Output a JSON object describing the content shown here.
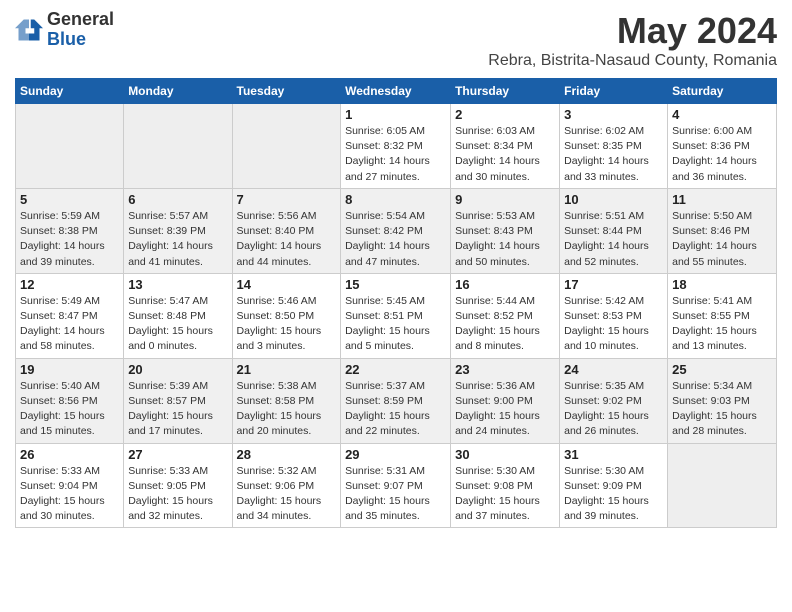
{
  "header": {
    "logo": {
      "line1": "General",
      "line2": "Blue"
    },
    "title": "May 2024",
    "location": "Rebra, Bistrita-Nasaud County, Romania"
  },
  "calendar": {
    "weekdays": [
      "Sunday",
      "Monday",
      "Tuesday",
      "Wednesday",
      "Thursday",
      "Friday",
      "Saturday"
    ],
    "weeks": [
      [
        {
          "day": "",
          "info": ""
        },
        {
          "day": "",
          "info": ""
        },
        {
          "day": "",
          "info": ""
        },
        {
          "day": "1",
          "info": "Sunrise: 6:05 AM\nSunset: 8:32 PM\nDaylight: 14 hours\nand 27 minutes."
        },
        {
          "day": "2",
          "info": "Sunrise: 6:03 AM\nSunset: 8:34 PM\nDaylight: 14 hours\nand 30 minutes."
        },
        {
          "day": "3",
          "info": "Sunrise: 6:02 AM\nSunset: 8:35 PM\nDaylight: 14 hours\nand 33 minutes."
        },
        {
          "day": "4",
          "info": "Sunrise: 6:00 AM\nSunset: 8:36 PM\nDaylight: 14 hours\nand 36 minutes."
        }
      ],
      [
        {
          "day": "5",
          "info": "Sunrise: 5:59 AM\nSunset: 8:38 PM\nDaylight: 14 hours\nand 39 minutes."
        },
        {
          "day": "6",
          "info": "Sunrise: 5:57 AM\nSunset: 8:39 PM\nDaylight: 14 hours\nand 41 minutes."
        },
        {
          "day": "7",
          "info": "Sunrise: 5:56 AM\nSunset: 8:40 PM\nDaylight: 14 hours\nand 44 minutes."
        },
        {
          "day": "8",
          "info": "Sunrise: 5:54 AM\nSunset: 8:42 PM\nDaylight: 14 hours\nand 47 minutes."
        },
        {
          "day": "9",
          "info": "Sunrise: 5:53 AM\nSunset: 8:43 PM\nDaylight: 14 hours\nand 50 minutes."
        },
        {
          "day": "10",
          "info": "Sunrise: 5:51 AM\nSunset: 8:44 PM\nDaylight: 14 hours\nand 52 minutes."
        },
        {
          "day": "11",
          "info": "Sunrise: 5:50 AM\nSunset: 8:46 PM\nDaylight: 14 hours\nand 55 minutes."
        }
      ],
      [
        {
          "day": "12",
          "info": "Sunrise: 5:49 AM\nSunset: 8:47 PM\nDaylight: 14 hours\nand 58 minutes."
        },
        {
          "day": "13",
          "info": "Sunrise: 5:47 AM\nSunset: 8:48 PM\nDaylight: 15 hours\nand 0 minutes."
        },
        {
          "day": "14",
          "info": "Sunrise: 5:46 AM\nSunset: 8:50 PM\nDaylight: 15 hours\nand 3 minutes."
        },
        {
          "day": "15",
          "info": "Sunrise: 5:45 AM\nSunset: 8:51 PM\nDaylight: 15 hours\nand 5 minutes."
        },
        {
          "day": "16",
          "info": "Sunrise: 5:44 AM\nSunset: 8:52 PM\nDaylight: 15 hours\nand 8 minutes."
        },
        {
          "day": "17",
          "info": "Sunrise: 5:42 AM\nSunset: 8:53 PM\nDaylight: 15 hours\nand 10 minutes."
        },
        {
          "day": "18",
          "info": "Sunrise: 5:41 AM\nSunset: 8:55 PM\nDaylight: 15 hours\nand 13 minutes."
        }
      ],
      [
        {
          "day": "19",
          "info": "Sunrise: 5:40 AM\nSunset: 8:56 PM\nDaylight: 15 hours\nand 15 minutes."
        },
        {
          "day": "20",
          "info": "Sunrise: 5:39 AM\nSunset: 8:57 PM\nDaylight: 15 hours\nand 17 minutes."
        },
        {
          "day": "21",
          "info": "Sunrise: 5:38 AM\nSunset: 8:58 PM\nDaylight: 15 hours\nand 20 minutes."
        },
        {
          "day": "22",
          "info": "Sunrise: 5:37 AM\nSunset: 8:59 PM\nDaylight: 15 hours\nand 22 minutes."
        },
        {
          "day": "23",
          "info": "Sunrise: 5:36 AM\nSunset: 9:00 PM\nDaylight: 15 hours\nand 24 minutes."
        },
        {
          "day": "24",
          "info": "Sunrise: 5:35 AM\nSunset: 9:02 PM\nDaylight: 15 hours\nand 26 minutes."
        },
        {
          "day": "25",
          "info": "Sunrise: 5:34 AM\nSunset: 9:03 PM\nDaylight: 15 hours\nand 28 minutes."
        }
      ],
      [
        {
          "day": "26",
          "info": "Sunrise: 5:33 AM\nSunset: 9:04 PM\nDaylight: 15 hours\nand 30 minutes."
        },
        {
          "day": "27",
          "info": "Sunrise: 5:33 AM\nSunset: 9:05 PM\nDaylight: 15 hours\nand 32 minutes."
        },
        {
          "day": "28",
          "info": "Sunrise: 5:32 AM\nSunset: 9:06 PM\nDaylight: 15 hours\nand 34 minutes."
        },
        {
          "day": "29",
          "info": "Sunrise: 5:31 AM\nSunset: 9:07 PM\nDaylight: 15 hours\nand 35 minutes."
        },
        {
          "day": "30",
          "info": "Sunrise: 5:30 AM\nSunset: 9:08 PM\nDaylight: 15 hours\nand 37 minutes."
        },
        {
          "day": "31",
          "info": "Sunrise: 5:30 AM\nSunset: 9:09 PM\nDaylight: 15 hours\nand 39 minutes."
        },
        {
          "day": "",
          "info": ""
        }
      ]
    ]
  }
}
